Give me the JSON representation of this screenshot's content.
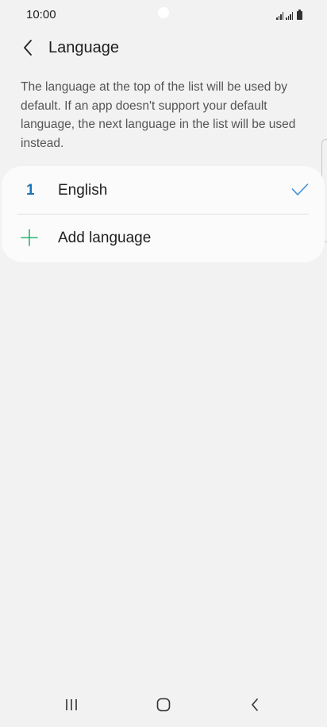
{
  "status_bar": {
    "time": "10:00"
  },
  "header": {
    "title": "Language",
    "back_icon": "chevron-left-icon"
  },
  "description": "The language at the top of the list will be used by default. If an app doesn't support your default language, the next language in the list will be used instead.",
  "languages": [
    {
      "index": "1",
      "name": "English",
      "selected": true
    }
  ],
  "add_language": {
    "label": "Add language",
    "icon": "plus-icon"
  },
  "nav_bar": {
    "recent_icon": "recent-apps-icon",
    "home_icon": "home-icon",
    "back_icon": "back-icon"
  },
  "colors": {
    "background": "#f2f2f2",
    "card": "#fbfbfb",
    "accent_blue": "#1a73b8",
    "check_blue": "#3d8fd8",
    "plus_green": "#2bb673"
  }
}
